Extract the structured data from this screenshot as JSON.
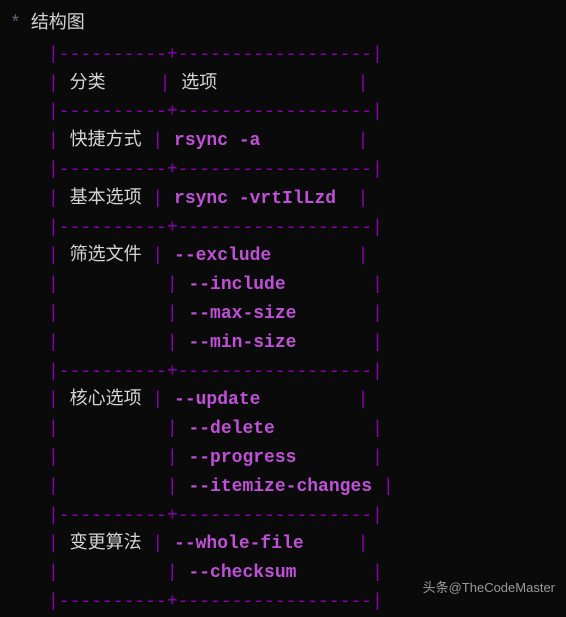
{
  "title": "结构图",
  "header": {
    "col1": "分类",
    "col2": "选项"
  },
  "rows": [
    {
      "label": "快捷方式",
      "values": [
        "rsync -a"
      ]
    },
    {
      "label": "基本选项",
      "values": [
        "rsync -vrtIlLzd"
      ]
    },
    {
      "label": "筛选文件",
      "values": [
        "--exclude",
        "--include",
        "--max-size",
        "--min-size"
      ]
    },
    {
      "label": "核心选项",
      "values": [
        "--update",
        "--delete",
        "--progress",
        "--itemize-changes"
      ]
    },
    {
      "label": "变更算法",
      "values": [
        "--whole-file",
        "--checksum"
      ]
    }
  ],
  "watermark": "头条@TheCodeMaster"
}
